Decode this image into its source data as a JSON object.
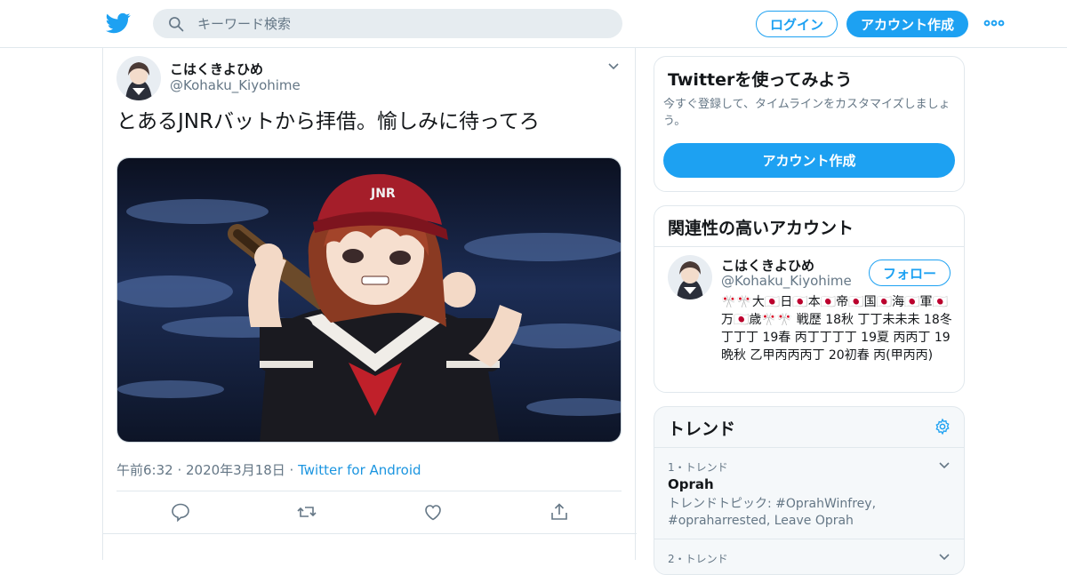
{
  "header": {
    "logo": "twitter-bird-icon",
    "search_placeholder": "キーワード検索",
    "login_label": "ログイン",
    "signup_label": "アカウント作成",
    "more_icon": "more-horizontal-icon",
    "accent_color": "#1da1f2"
  },
  "tweet": {
    "author_name": "こはくきよひめ",
    "author_handle": "@Kohaku_Kiyohime",
    "text": "とあるJNRバットから拝借。愉しみに待ってろ",
    "timestamp": "午前6:32 · 2020年3月18日 · ",
    "source": "Twitter for Android",
    "media_caption": "JNR",
    "actions": [
      "reply-icon",
      "retweet-icon",
      "like-icon",
      "share-icon"
    ]
  },
  "sidebar": {
    "signup_card": {
      "title": "Twitterを使ってみよう",
      "description": "今すぐ登録して、タイムラインをカスタマイズしましょう。",
      "button_label": "アカウント作成"
    },
    "related_card": {
      "title": "関連性の高いアカウント",
      "account": {
        "name": "こはくきよひめ",
        "handle": "@Kohaku_Kiyohime",
        "follow_label": "フォロー",
        "bio": "🎌🎌大🇯🇵日🇯🇵本🇯🇵帝🇯🇵国🇯🇵海🇯🇵軍🇯🇵万🇯🇵歳🎌🎌 戦歴 18秋 丁丁未未未 18冬 丁丁丁 19春 丙丁丁丁丁 19夏 丙丙丁 19晩秋 乙甲丙丙丙丁 20初春 丙(甲丙丙)"
      }
    },
    "trends_card": {
      "title": "トレンド",
      "items": [
        {
          "rank": "1・トレンド",
          "name": "Oprah",
          "description": "トレンドトピック: #OprahWinfrey, #opraharrested, Leave Oprah"
        },
        {
          "rank": "2・トレンド",
          "name": "",
          "description": ""
        }
      ]
    }
  }
}
